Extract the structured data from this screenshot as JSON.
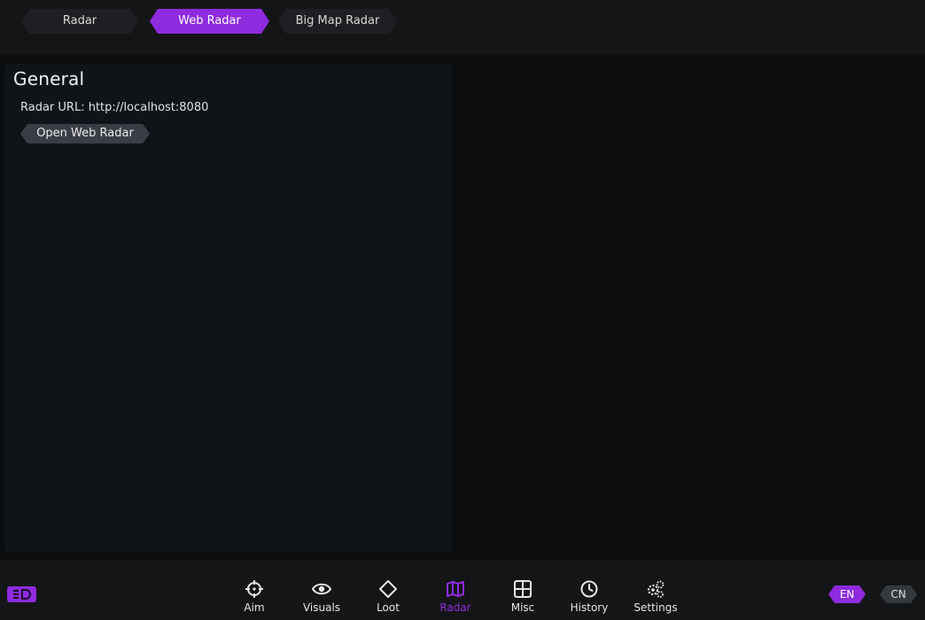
{
  "tabs": [
    {
      "label": "Radar",
      "active": false
    },
    {
      "label": "Web Radar",
      "active": true
    },
    {
      "label": "Big Map Radar",
      "active": false
    }
  ],
  "panel": {
    "title": "General",
    "radar_url_label": "Radar URL: http://localhost:8080",
    "open_button": "Open Web Radar"
  },
  "nav": [
    {
      "label": "Aim",
      "icon": "crosshair-icon"
    },
    {
      "label": "Visuals",
      "icon": "eye-icon"
    },
    {
      "label": "Loot",
      "icon": "diamond-icon"
    },
    {
      "label": "Radar",
      "icon": "map-icon",
      "active": true
    },
    {
      "label": "Misc",
      "icon": "grid-icon"
    },
    {
      "label": "History",
      "icon": "clock-icon"
    },
    {
      "label": "Settings",
      "icon": "gears-icon"
    }
  ],
  "lang": {
    "en": "EN",
    "cn": "CN",
    "active": "EN"
  },
  "colors": {
    "accent": "#8e2bdf",
    "panel": "#0f1418",
    "bar": "#141516",
    "background": "#0b0c0e"
  }
}
